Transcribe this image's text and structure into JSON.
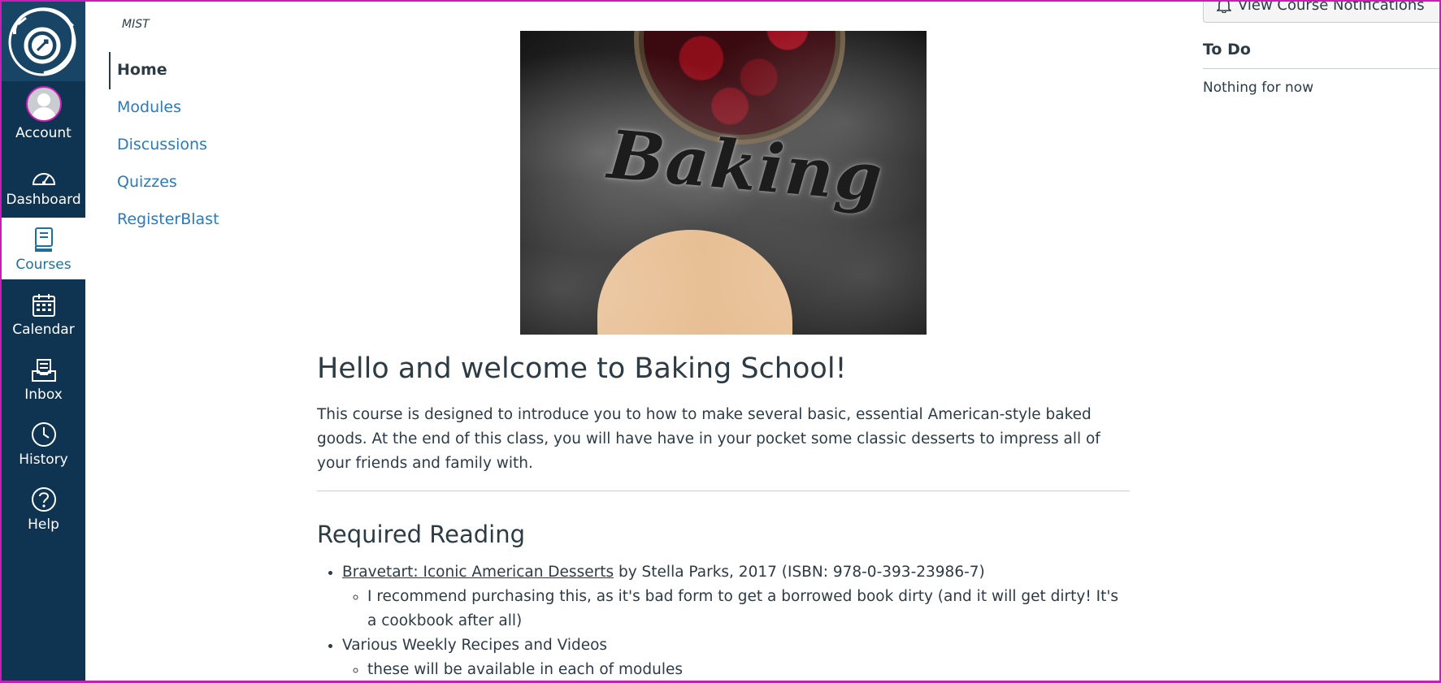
{
  "global_nav": {
    "items": [
      {
        "label": "Account",
        "icon": "avatar"
      },
      {
        "label": "Dashboard",
        "icon": "dashboard-icon"
      },
      {
        "label": "Courses",
        "icon": "courses-icon"
      },
      {
        "label": "Calendar",
        "icon": "calendar-icon"
      },
      {
        "label": "Inbox",
        "icon": "inbox-icon"
      },
      {
        "label": "History",
        "icon": "history-icon"
      },
      {
        "label": "Help",
        "icon": "help-icon"
      }
    ],
    "active_item": "Courses"
  },
  "course_nav": {
    "breadcrumb": "MIST",
    "items": [
      {
        "label": "Home"
      },
      {
        "label": "Modules"
      },
      {
        "label": "Discussions"
      },
      {
        "label": "Quizzes"
      },
      {
        "label": "RegisterBlast"
      }
    ],
    "active_item": "Home"
  },
  "main": {
    "banner_text": "Baking",
    "heading": "Hello and welcome to Baking School!",
    "intro": "This course is designed to introduce you to how to make several basic, essential American-style baked goods. At the end of this class, you will have have in your pocket some classic desserts to impress all of your friends and family with.",
    "reading_heading": "Required Reading",
    "reading": [
      {
        "link": "Bravetart: Iconic American Desserts",
        "rest": " by Stella Parks, 2017 (ISBN: 978-0-393-23986-7)",
        "sub": [
          "I recommend purchasing this, as it's bad form to get a borrowed book dirty (and it will get dirty! It's a cookbook after all)"
        ]
      },
      {
        "text": "Various Weekly Recipes and Videos",
        "sub": [
          "these will be available in each of modules"
        ]
      }
    ]
  },
  "sidebar": {
    "notifications_button": "View Course Notifications",
    "todo_title": "To Do",
    "todo_empty": "Nothing for now"
  },
  "colors": {
    "nav_bg": "#0e3451",
    "link": "#2b7abc",
    "frame": "#c71fb3",
    "text": "#2d3b45"
  }
}
